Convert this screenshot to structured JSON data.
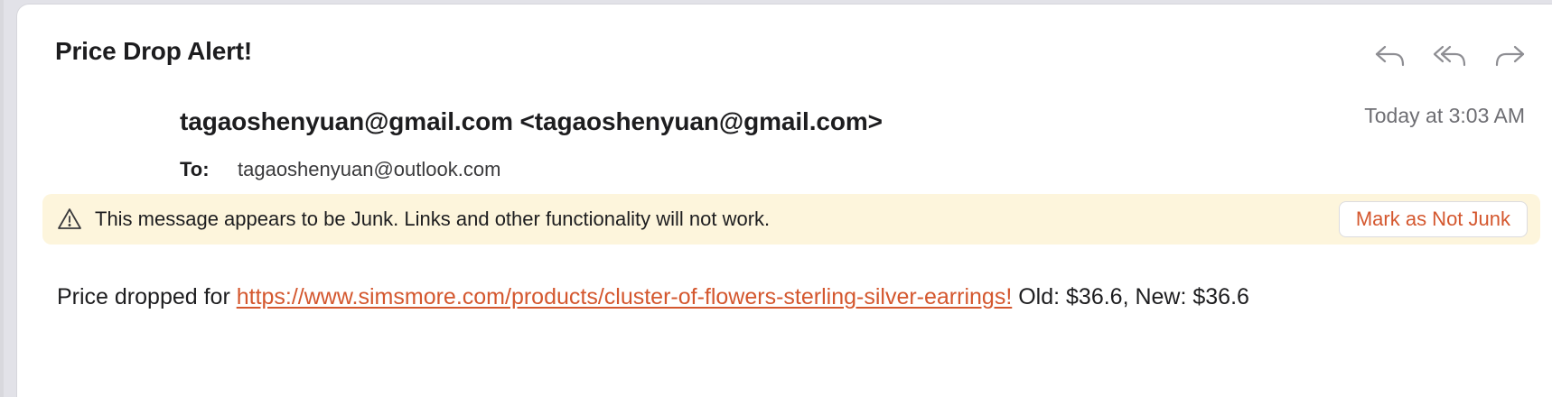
{
  "email": {
    "subject": "Price Drop Alert!",
    "sender": "tagaoshenyuan@gmail.com <tagaoshenyuan@gmail.com>",
    "timestamp": "Today at 3:03 AM",
    "to_label": "To:",
    "to_address": "tagaoshenyuan@outlook.com"
  },
  "toolbar": {
    "icons": [
      "reply-icon",
      "reply-all-icon",
      "forward-icon"
    ]
  },
  "junk_banner": {
    "icon": "warning-triangle-icon",
    "message": "This message appears to be Junk. Links and other functionality will not work.",
    "button_label": "Mark as Not Junk"
  },
  "body": {
    "prefix": "Price dropped for ",
    "link": "https://www.simsmore.com/products/cluster-of-flowers-sterling-silver-earrings!",
    "suffix": " Old: $36.6, New: $36.6"
  },
  "colors": {
    "accent": "#d4572e",
    "banner_bg": "#fdf5dc",
    "text": "#1d1d1f",
    "secondary_text": "#6e6e73"
  }
}
